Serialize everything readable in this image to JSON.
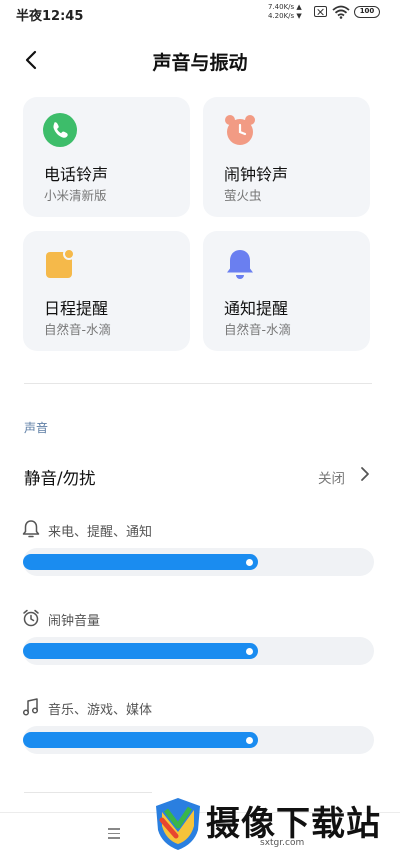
{
  "status_bar": {
    "time": "半夜12:45",
    "net_up": "7.40K/s ▲",
    "net_down": "4.20K/s ▼",
    "battery": "100"
  },
  "header": {
    "title": "声音与振动",
    "back_icon": "chevron-left-icon"
  },
  "cards": [
    {
      "title": "电话铃声",
      "subtitle": "小米清新版",
      "icon": "phone-icon",
      "color": "#3dbd6a"
    },
    {
      "title": "闹钟铃声",
      "subtitle": "萤火虫",
      "icon": "alarm-clock-icon",
      "color": "#f29b84"
    },
    {
      "title": "日程提醒",
      "subtitle": "自然音-水滴",
      "icon": "calendar-icon",
      "color": "#f5b94a"
    },
    {
      "title": "通知提醒",
      "subtitle": "自然音-水滴",
      "icon": "bell-icon",
      "color": "#6a7ff0"
    }
  ],
  "sound_section": {
    "label": "声音",
    "dnd": {
      "label": "静音/勿扰",
      "value": "关闭"
    },
    "volumes": [
      {
        "label": "来电、提醒、通知",
        "icon": "bell-outline-icon",
        "level": 0.67
      },
      {
        "label": "闹钟音量",
        "icon": "alarm-outline-icon",
        "level": 0.67
      },
      {
        "label": "音乐、游戏、媒体",
        "icon": "music-note-icon",
        "level": 0.67
      }
    ]
  },
  "accent_color": "#1a8cf0",
  "watermark": {
    "text": "摄像下载站",
    "url": "sxtgr.com"
  }
}
